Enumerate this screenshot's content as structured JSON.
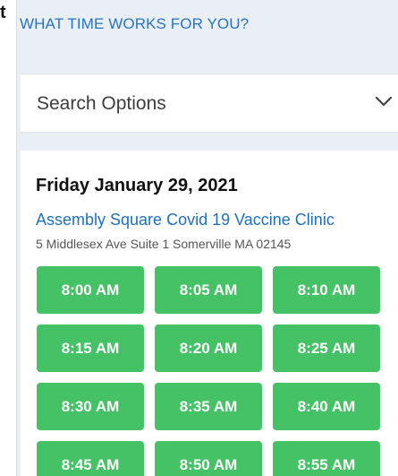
{
  "edge_glyph": "t",
  "section_header": "WHAT TIME WORKS FOR YOU?",
  "search": {
    "label": "Search Options",
    "icon": "chevron-down-icon"
  },
  "date_heading": "Friday January 29, 2021",
  "clinic": {
    "name": "Assembly Square Covid 19 Vaccine Clinic",
    "address": "5 Middlesex Ave Suite 1 Somerville MA 02145"
  },
  "time_slots": [
    "8:00 AM",
    "8:05 AM",
    "8:10 AM",
    "8:15 AM",
    "8:20 AM",
    "8:25 AM",
    "8:30 AM",
    "8:35 AM",
    "8:40 AM",
    "8:45 AM",
    "8:50 AM",
    "8:55 AM"
  ],
  "colors": {
    "header_blue": "#2a73c4",
    "link_blue": "#1f6fbf",
    "slot_green": "#45c265",
    "panel_bg": "#e9eff5"
  }
}
